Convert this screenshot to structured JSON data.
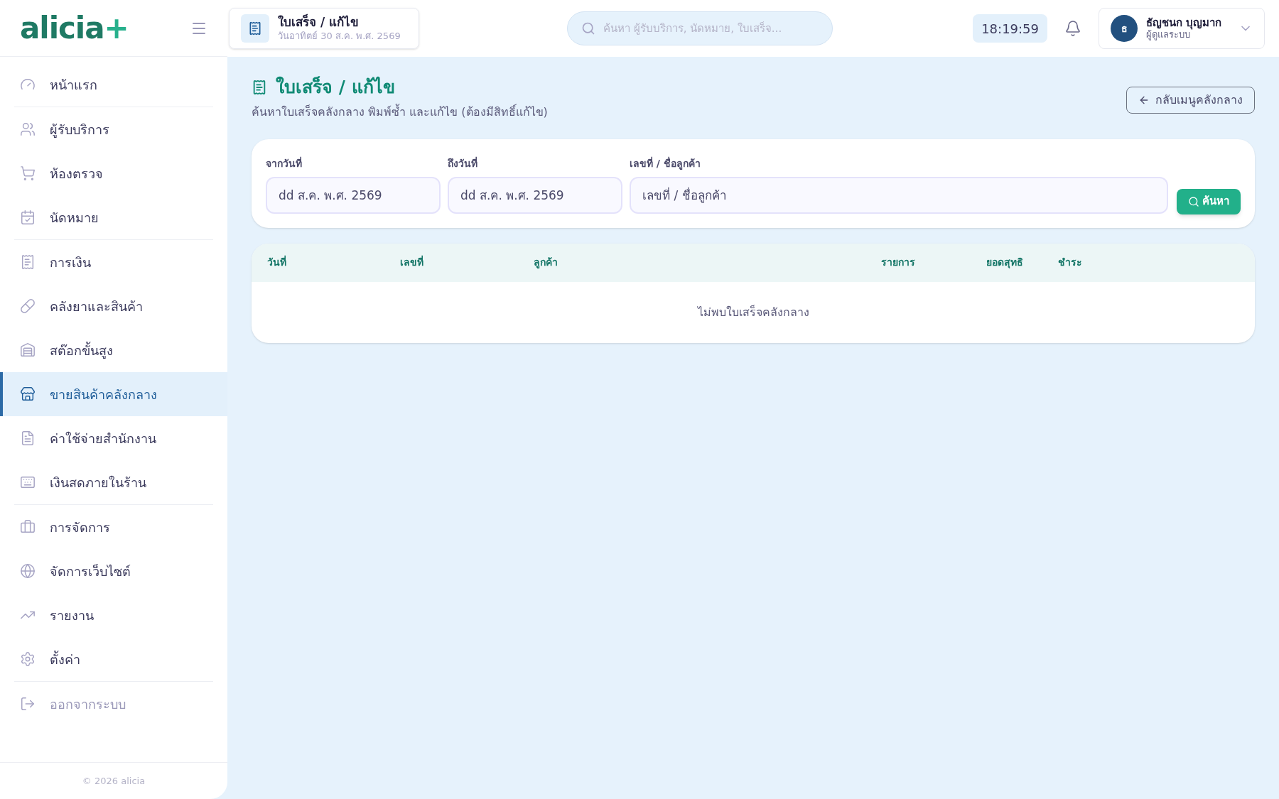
{
  "brand": {
    "name": "alicia",
    "mark": "+"
  },
  "page_chip": {
    "title": "ใบเสร็จ / แก้ไข",
    "date": "วันอาทิตย์ 30 ส.ค. พ.ศ. 2569"
  },
  "search": {
    "placeholder": "ค้นหา ผู้รับบริการ, นัดหมาย, ใบเสร็จ..."
  },
  "clock": "18:19:59",
  "user": {
    "initial": "ธ",
    "name": "ธัญชนก บุญมาก",
    "role": "ผู้ดูแลระบบ"
  },
  "sidebar": {
    "groups": [
      [
        {
          "label": "หน้าแรก",
          "selected": false
        }
      ],
      [
        {
          "label": "ผู้รับบริการ",
          "selected": false
        },
        {
          "label": "ห้องตรวจ",
          "selected": false
        },
        {
          "label": "นัดหมาย",
          "selected": false
        }
      ],
      [
        {
          "label": "การเงิน",
          "selected": false
        },
        {
          "label": "คลังยาและสินค้า",
          "selected": false
        },
        {
          "label": "สต๊อกขั้นสูง",
          "selected": false
        },
        {
          "label": "ขายสินค้าคลังกลาง",
          "selected": true
        },
        {
          "label": "ค่าใช้จ่ายสำนักงาน",
          "selected": false
        },
        {
          "label": "เงินสดภายในร้าน",
          "selected": false
        }
      ],
      [
        {
          "label": "การจัดการ",
          "selected": false
        },
        {
          "label": "จัดการเว็บไซต์",
          "selected": false
        },
        {
          "label": "รายงาน",
          "selected": false
        },
        {
          "label": "ตั้งค่า",
          "selected": false
        }
      ],
      [
        {
          "label": "ออกจากระบบ",
          "selected": false
        }
      ]
    ],
    "footer": "© 2026 alicia"
  },
  "header": {
    "title": "ใบเสร็จ / แก้ไข",
    "subtitle": "ค้นหาใบเสร็จคลังกลาง พิมพ์ซ้ำ และแก้ไข (ต้องมีสิทธิ์แก้ไข)",
    "back_button": "กลับเมนูคลังกลาง"
  },
  "filters": {
    "fields": [
      {
        "label": "จากวันที่",
        "value": "dd ส.ค. พ.ศ. 2569"
      },
      {
        "label": "ถึงวันที่",
        "value": "dd ส.ค. พ.ศ. 2569"
      },
      {
        "label": "เลขที่ / ชื่อลูกค้า",
        "placeholder": "เลขที่ / ชื่อลูกค้า"
      }
    ],
    "button": "ค้นหา"
  },
  "table": {
    "columns": [
      "วันที่",
      "เลขที่",
      "ลูกค้า",
      "รายการ",
      "ยอดสุทธิ",
      "ชำระ"
    ],
    "empty": "ไม่พบใบเสร็จคลังกลาง"
  }
}
